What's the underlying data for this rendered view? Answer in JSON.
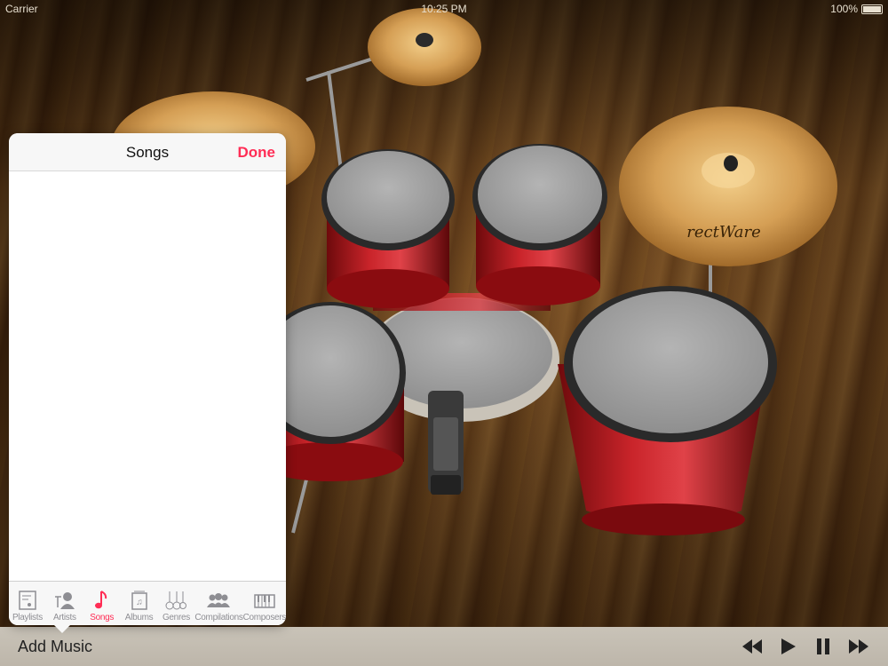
{
  "status_bar": {
    "carrier": "Carrier",
    "time": "10:25 PM",
    "battery": "100%"
  },
  "kit": {
    "cymbal_brand": "rectWare"
  },
  "popover": {
    "title": "Songs",
    "done_label": "Done",
    "active_tab": "Songs",
    "tabs": [
      {
        "label": "Playlists",
        "icon": "playlists-icon"
      },
      {
        "label": "Artists",
        "icon": "artists-icon"
      },
      {
        "label": "Songs",
        "icon": "note-icon"
      },
      {
        "label": "Albums",
        "icon": "albums-icon"
      },
      {
        "label": "Genres",
        "icon": "genres-icon"
      },
      {
        "label": "Compilations",
        "icon": "compilations-icon"
      },
      {
        "label": "Composers",
        "icon": "composers-icon"
      }
    ]
  },
  "toolbar": {
    "add_music_label": "Add Music",
    "controls": [
      "rewind-icon",
      "play-icon",
      "pause-icon",
      "fast-forward-icon"
    ]
  },
  "colors": {
    "accent": "#ff2d55",
    "toolbar_bg": "#c5beb2",
    "drum_shell": "#b5141a",
    "cymbal": "#d9a55a"
  }
}
